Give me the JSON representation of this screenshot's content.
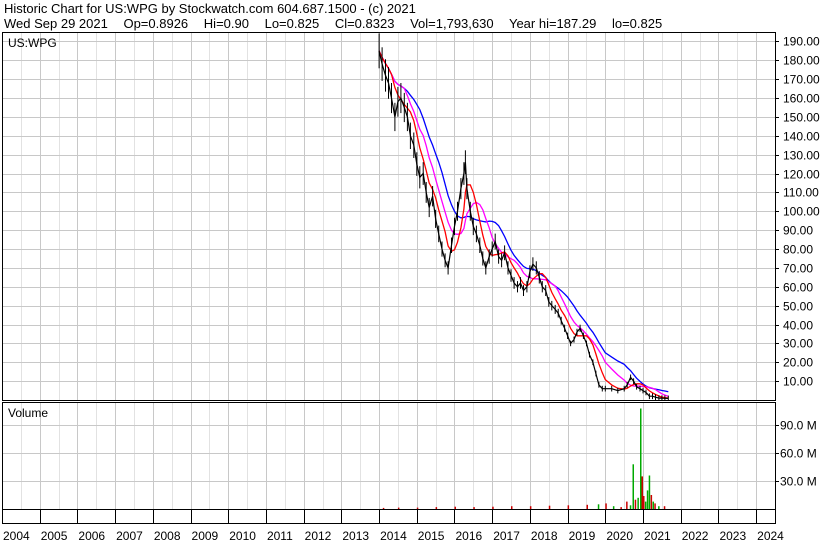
{
  "header": {
    "title": "Historic Chart for US:WPG by Stockwatch.com 604.687.1500 - (c) 2021",
    "date": "Wed Sep 29 2021",
    "open": "Op=0.8926",
    "high": "Hi=0.90",
    "low": "Lo=0.825",
    "close": "Cl=0.8323",
    "volume": "Vol=1,793,630",
    "year_high": "Year hi=187.29",
    "year_low": "lo=0.825"
  },
  "colors": {
    "background": "#ffffff",
    "grid": "#c8c8c8",
    "price_bars": "#000000",
    "ma_short": "#ff0000",
    "ma_mid": "#ff00ff",
    "ma_long": "#0000ff",
    "volume_up": "#00aa00",
    "volume_down": "#cc0000"
  },
  "chart_data": [
    {
      "type": "line",
      "label": "US:WPG",
      "y_unit": "USD",
      "ylim": [
        0,
        195
      ],
      "y_ticks": [
        10,
        20,
        30,
        40,
        50,
        60,
        70,
        80,
        90,
        100,
        110,
        120,
        130,
        140,
        150,
        160,
        170,
        180,
        190
      ],
      "y_tick_labels": [
        "10.00",
        "20.00",
        "30.00",
        "40.00",
        "50.00",
        "60.00",
        "70.00",
        "80.00",
        "90.00",
        "100.00",
        "110.00",
        "120.00",
        "130.00",
        "140.00",
        "150.00",
        "160.00",
        "170.00",
        "180.00",
        "190.00"
      ],
      "x_range": [
        2004.0,
        2024.5
      ],
      "grid": true,
      "series": [
        {
          "style": "price",
          "points": [
            [
              2014.0,
              185
            ],
            [
              2014.08,
              178
            ],
            [
              2014.17,
              172
            ],
            [
              2014.25,
              168
            ],
            [
              2014.33,
              160
            ],
            [
              2014.42,
              150
            ],
            [
              2014.5,
              158
            ],
            [
              2014.58,
              160
            ],
            [
              2014.67,
              155
            ],
            [
              2014.75,
              150
            ],
            [
              2014.83,
              140
            ],
            [
              2014.92,
              135
            ],
            [
              2015.0,
              125
            ],
            [
              2015.08,
              118
            ],
            [
              2015.17,
              120
            ],
            [
              2015.25,
              110
            ],
            [
              2015.33,
              102
            ],
            [
              2015.42,
              108
            ],
            [
              2015.5,
              96
            ],
            [
              2015.58,
              88
            ],
            [
              2015.67,
              80
            ],
            [
              2015.75,
              74
            ],
            [
              2015.83,
              70
            ],
            [
              2015.92,
              82
            ],
            [
              2016.0,
              92
            ],
            [
              2016.08,
              100
            ],
            [
              2016.17,
              112
            ],
            [
              2016.25,
              120
            ],
            [
              2016.29,
              126
            ],
            [
              2016.33,
              112
            ],
            [
              2016.42,
              100
            ],
            [
              2016.5,
              92
            ],
            [
              2016.58,
              88
            ],
            [
              2016.67,
              82
            ],
            [
              2016.75,
              75
            ],
            [
              2016.83,
              70
            ],
            [
              2016.92,
              76
            ],
            [
              2017.0,
              80
            ],
            [
              2017.08,
              84
            ],
            [
              2017.17,
              76
            ],
            [
              2017.25,
              74
            ],
            [
              2017.33,
              78
            ],
            [
              2017.42,
              70
            ],
            [
              2017.5,
              66
            ],
            [
              2017.58,
              62
            ],
            [
              2017.67,
              60
            ],
            [
              2017.75,
              62
            ],
            [
              2017.83,
              58
            ],
            [
              2017.92,
              60
            ],
            [
              2018.0,
              68
            ],
            [
              2018.08,
              72
            ],
            [
              2018.17,
              70
            ],
            [
              2018.25,
              65
            ],
            [
              2018.33,
              60
            ],
            [
              2018.42,
              58
            ],
            [
              2018.5,
              52
            ],
            [
              2018.58,
              50
            ],
            [
              2018.67,
              48
            ],
            [
              2018.75,
              46
            ],
            [
              2018.83,
              42
            ],
            [
              2018.92,
              38
            ],
            [
              2019.0,
              34
            ],
            [
              2019.08,
              30
            ],
            [
              2019.17,
              32
            ],
            [
              2019.25,
              36
            ],
            [
              2019.33,
              38
            ],
            [
              2019.42,
              34
            ],
            [
              2019.5,
              30
            ],
            [
              2019.58,
              24
            ],
            [
              2019.67,
              20
            ],
            [
              2019.75,
              14
            ],
            [
              2019.83,
              8
            ],
            [
              2019.92,
              6
            ],
            [
              2020.0,
              6
            ],
            [
              2020.17,
              6
            ],
            [
              2020.33,
              5
            ],
            [
              2020.5,
              6
            ],
            [
              2020.58,
              8
            ],
            [
              2020.67,
              12
            ],
            [
              2020.75,
              10
            ],
            [
              2020.83,
              7
            ],
            [
              2020.92,
              6
            ],
            [
              2021.0,
              5
            ],
            [
              2021.08,
              4
            ],
            [
              2021.17,
              2
            ],
            [
              2021.25,
              2
            ],
            [
              2021.33,
              1.5
            ],
            [
              2021.42,
              1
            ],
            [
              2021.5,
              1
            ],
            [
              2021.58,
              0.9
            ],
            [
              2021.67,
              0.8323
            ]
          ]
        },
        {
          "style": "ma_short",
          "window": 5
        },
        {
          "style": "ma_mid",
          "window": 9
        },
        {
          "style": "ma_long",
          "window": 14
        }
      ]
    },
    {
      "type": "bar",
      "label": "Volume",
      "y_unit": "shares (M)",
      "ylim": [
        0,
        115
      ],
      "y_ticks": [
        30,
        60,
        90
      ],
      "y_tick_labels": [
        "30.0 M",
        "60.0 M",
        "90.0 M"
      ],
      "x_tick_labels": [
        "2004",
        "2005",
        "2006",
        "2007",
        "2008",
        "2009",
        "2010",
        "2011",
        "2012",
        "2013",
        "2014",
        "2015",
        "2016",
        "2017",
        "2018",
        "2019",
        "2020",
        "2021",
        "2022",
        "2023",
        "2024"
      ],
      "bars": [
        [
          2014.1,
          1.2,
          "down"
        ],
        [
          2014.5,
          1.5,
          "down"
        ],
        [
          2015.0,
          1.5,
          "down"
        ],
        [
          2015.5,
          2.0,
          "down"
        ],
        [
          2016.0,
          2.5,
          "down"
        ],
        [
          2016.5,
          2.0,
          "down"
        ],
        [
          2017.0,
          2.5,
          "down"
        ],
        [
          2017.5,
          3.0,
          "down"
        ],
        [
          2018.0,
          3.0,
          "down"
        ],
        [
          2018.5,
          3.5,
          "down"
        ],
        [
          2019.0,
          4.0,
          "down"
        ],
        [
          2019.5,
          4.5,
          "down"
        ],
        [
          2019.8,
          5.0,
          "up"
        ],
        [
          2020.0,
          6.0,
          "down"
        ],
        [
          2020.2,
          3.0,
          "up"
        ],
        [
          2020.4,
          2.0,
          "down"
        ],
        [
          2020.55,
          8.0,
          "down"
        ],
        [
          2020.65,
          4.0,
          "up"
        ],
        [
          2020.72,
          48.0,
          "up"
        ],
        [
          2020.78,
          10.0,
          "down"
        ],
        [
          2020.85,
          12.0,
          "up"
        ],
        [
          2020.92,
          108.0,
          "up"
        ],
        [
          2020.96,
          35.0,
          "down"
        ],
        [
          2021.0,
          14.0,
          "down"
        ],
        [
          2021.05,
          8.0,
          "up"
        ],
        [
          2021.1,
          20.0,
          "up"
        ],
        [
          2021.15,
          36.0,
          "up"
        ],
        [
          2021.2,
          15.0,
          "down"
        ],
        [
          2021.25,
          8.0,
          "up"
        ],
        [
          2021.3,
          6.0,
          "down"
        ],
        [
          2021.4,
          3.0,
          "up"
        ],
        [
          2021.55,
          3.0,
          "down"
        ]
      ]
    }
  ]
}
